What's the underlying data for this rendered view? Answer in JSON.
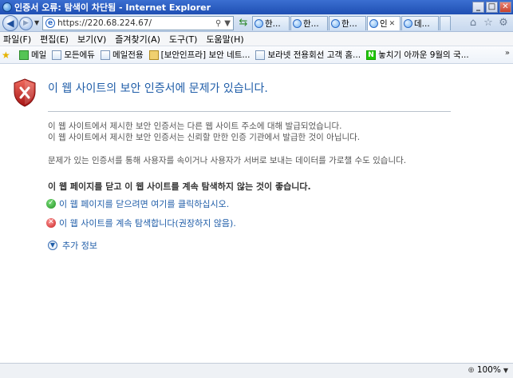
{
  "window": {
    "title": "인증서 오류: 탐색이 차단됨 - Internet Explorer",
    "buttons": [
      "_",
      "□",
      "✕"
    ]
  },
  "nav": {
    "url": "https://220.68.224.67/",
    "back_icon": "back-arrow-icon",
    "forward_icon": "forward-arrow-icon",
    "search_icon": "search-icon",
    "tabs": [
      {
        "label": "한..."
      },
      {
        "label": "한..."
      },
      {
        "label": "한..."
      },
      {
        "label": "인"
      },
      {
        "label": "데..."
      }
    ],
    "tab_close": "✕"
  },
  "menu": {
    "items": [
      "파일(F)",
      "편집(E)",
      "보기(V)",
      "즐겨찾기(A)",
      "도구(T)",
      "도움말(H)"
    ]
  },
  "favorites": {
    "items": [
      {
        "label": "메일"
      },
      {
        "label": "모든에듀"
      },
      {
        "label": "메일전용"
      },
      {
        "label": "[보안인프라] 보안 네트..."
      },
      {
        "label": "보라넷 전용회선 고객 홈..."
      },
      {
        "label": "놓치기 아까운 9월의 국..."
      }
    ],
    "more": "»"
  },
  "content": {
    "heading": "이 웹 사이트의 보안 인증서에 문제가 있습니다.",
    "para1_line1": "이 웹 사이트에서 제시한 보안 인증서는 다른 웹 사이트 주소에 대해 발급되었습니다.",
    "para1_line2": "이 웹 사이트에서 제시한 보안 인증서는 신뢰할 만한 인증 기관에서 발급한 것이 아닙니다.",
    "para2": "문제가 있는 인증서를 통해 사용자를 속이거나 사용자가 서버로 보내는 데이터를 가로챌 수도 있습니다.",
    "recommendation": "이 웹 페이지를 닫고 이 웹 사이트를 계속 탐색하지 않는 것이 좋습니다.",
    "close_link": "이 웹 페이지를 닫으려면 여기를 클릭하십시오.",
    "continue_link": "이 웹 사이트를 계속 탐색합니다(권장하지 않음).",
    "more_info": "추가 정보"
  },
  "status": {
    "zoom": "100%"
  },
  "colors": {
    "heading": "#1f5da8",
    "titlebar": "#2a5cc2",
    "shield": "#c0282a"
  }
}
